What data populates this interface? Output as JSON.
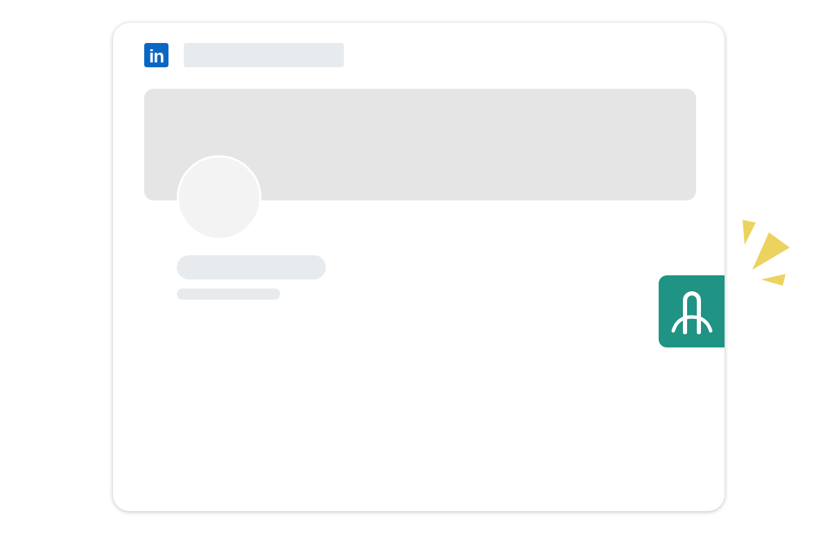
{
  "logo": {
    "text": "in"
  }
}
